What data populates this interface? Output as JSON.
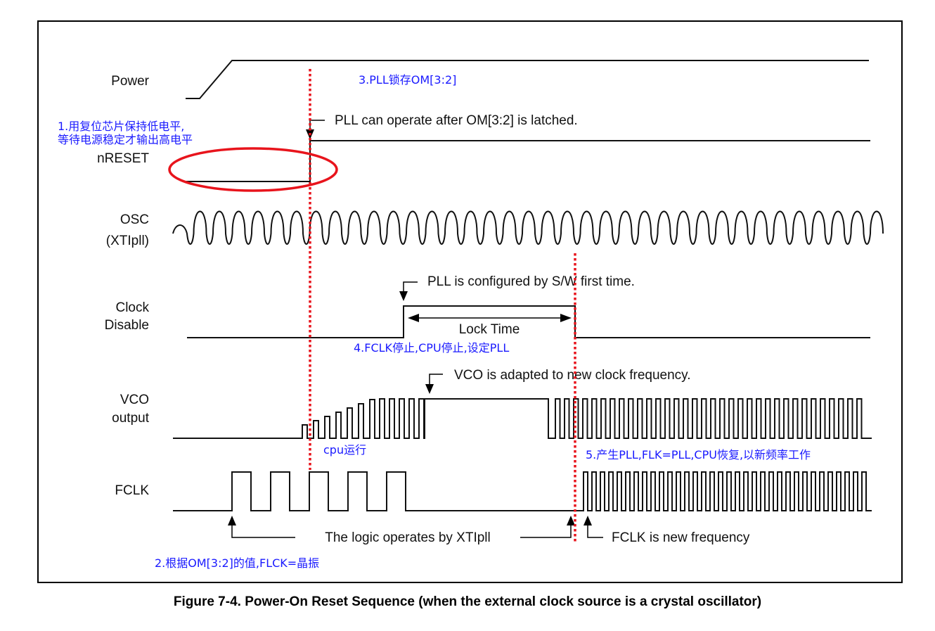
{
  "signals": {
    "power": "Power",
    "nreset": "nRESET",
    "osc_line1": "OSC",
    "osc_line2": "(XTIpll)",
    "clock_disable_line1": "Clock",
    "clock_disable_line2": "Disable",
    "vco_line1": "VCO",
    "vco_line2": "output",
    "fclk": "FCLK"
  },
  "notes": {
    "pll_operate": "PLL can operate after OM[3:2] is latched.",
    "pll_configured": "PLL is configured by S/W first time.",
    "lock_time": "Lock Time",
    "vco_adapted": "VCO is adapted to new clock frequency.",
    "logic_xtipll": "The logic operates by XTIpll",
    "fclk_new": "FCLK is new frequency"
  },
  "annotations": {
    "step1_line1": "1.用复位芯片保持低电平,",
    "step1_line2": "等待电源稳定才输出高电平",
    "step2": "2.根据OM[3:2]的值,FLCK=晶振",
    "step3": "3.PLL锁存OM[3:2]",
    "step4": "4.FCLK停止,CPU停止,设定PLL",
    "step5": "5.产生PLL,FLK=PLL,CPU恢复,以新频率工作",
    "cpu_running": "cpu运行"
  },
  "caption": "Figure 7-4. Power-On Reset Sequence (when the external clock source is a crystal oscillator)",
  "colors": {
    "annotation_text": "#1a1aff",
    "highlight_red": "#e8141c",
    "wave": "#111111"
  }
}
